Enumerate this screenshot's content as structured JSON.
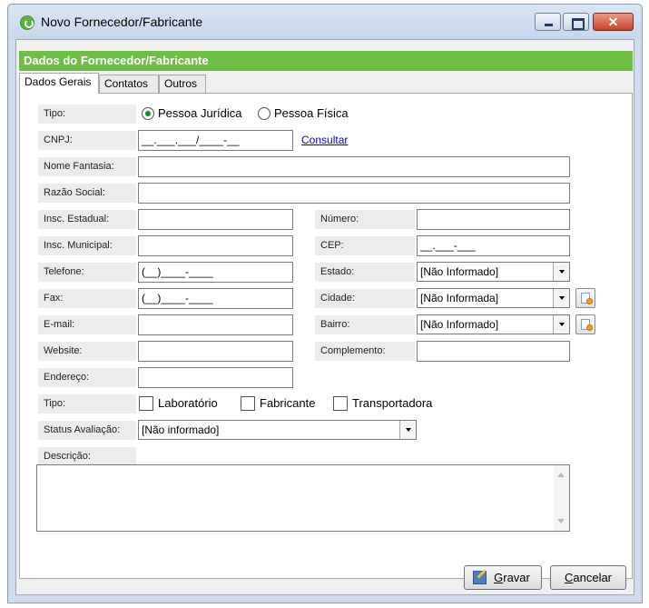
{
  "window": {
    "title": "Novo Fornecedor/Fabricante"
  },
  "header": {
    "title": "Dados do Fornecedor/Fabricante"
  },
  "tabs": [
    {
      "label": "Dados Gerais",
      "active": true
    },
    {
      "label": "Contatos",
      "active": false
    },
    {
      "label": "Outros",
      "active": false
    }
  ],
  "form": {
    "tipo_label": "Tipo:",
    "tipo_options": [
      {
        "label": "Pessoa Jurídica",
        "selected": true
      },
      {
        "label": "Pessoa Física",
        "selected": false
      }
    ],
    "cnpj_label": "CNPJ:",
    "cnpj_value": "__.___.___/____-__",
    "consultar_link": "Consultar",
    "nome_fantasia_label": "Nome Fantasia:",
    "nome_fantasia_value": "",
    "razao_social_label": "Razão Social:",
    "razao_social_value": "",
    "insc_estadual_label": "Insc. Estadual:",
    "insc_estadual_value": "",
    "numero_label": "Número:",
    "numero_value": "",
    "insc_municipal_label": "Insc. Municipal:",
    "insc_municipal_value": "",
    "cep_label": "CEP:",
    "cep_value": "__.___-___",
    "telefone_label": "Telefone:",
    "telefone_value": "(__)____-____",
    "estado_label": "Estado:",
    "estado_value": "[Não Informado]",
    "fax_label": "Fax:",
    "fax_value": "(__)____-____",
    "cidade_label": "Cidade:",
    "cidade_value": "[Não Informada]",
    "email_label": "E-mail:",
    "email_value": "",
    "bairro_label": "Bairro:",
    "bairro_value": "[Não Informado]",
    "website_label": "Website:",
    "website_value": "",
    "complemento_label": "Complemento:",
    "complemento_value": "",
    "endereco_label": "Endereço:",
    "endereco_value": "",
    "tipo2_label": "Tipo:",
    "tipo2_options": [
      {
        "label": "Laboratório",
        "checked": false
      },
      {
        "label": "Fabricante",
        "checked": false
      },
      {
        "label": "Transportadora",
        "checked": false
      }
    ],
    "status_label": "Status Avaliação:",
    "status_value": "[Não informado]",
    "descricao_label": "Descrição:",
    "descricao_value": ""
  },
  "footer": {
    "gravar_u": "G",
    "gravar_rest": "ravar",
    "cancelar_u": "C",
    "cancelar_rest": "ancelar"
  },
  "colors": {
    "header_green": "#6dbe45",
    "link_blue": "#0000cc",
    "close_red": "#c7412a"
  },
  "icons": [
    "app-logo-icon",
    "minimize-icon",
    "maximize-icon",
    "close-icon",
    "add-record-icon",
    "save-icon"
  ]
}
